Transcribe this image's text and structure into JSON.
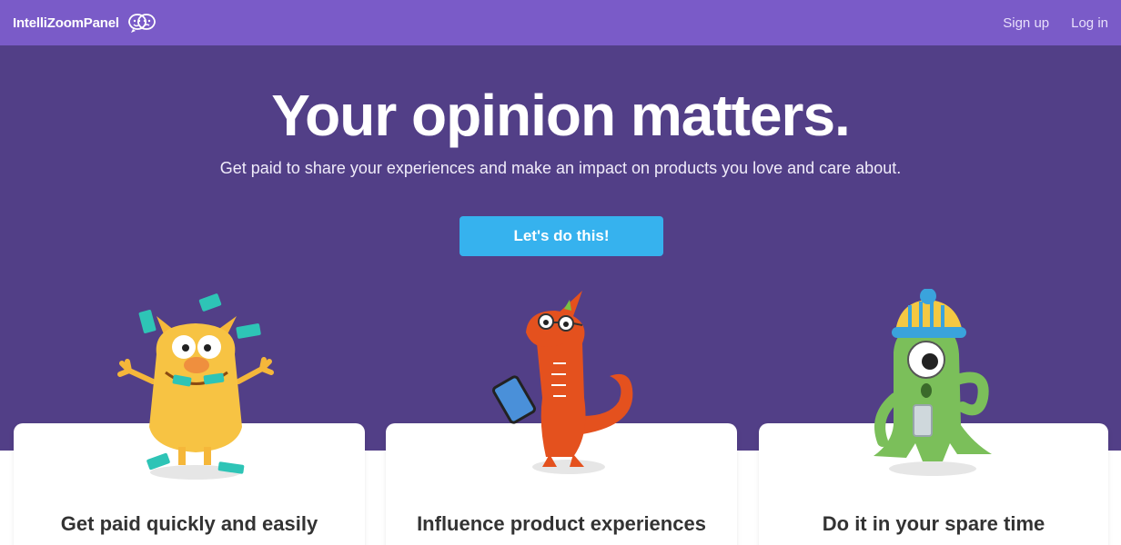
{
  "navbar": {
    "brand": "IntelliZoomPanel",
    "logo_icon": "speech-bubbles-faces-icon",
    "links": [
      {
        "label": "Sign up"
      },
      {
        "label": "Log in"
      }
    ]
  },
  "hero": {
    "title": "Your opinion matters.",
    "subtitle": "Get paid to share your experiences and make an impact on products you love and care about.",
    "cta_label": "Let's do this!"
  },
  "cards": [
    {
      "title": "Get paid quickly and easily",
      "icon": "yellow-monster-with-money-icon"
    },
    {
      "title": "Influence product experiences",
      "icon": "orange-dragon-with-tablet-icon"
    },
    {
      "title": "Do it in your spare time",
      "icon": "green-cyclops-with-phone-icon"
    }
  ],
  "colors": {
    "nav_bg": "#7a5bc8",
    "hero_bg": "#523f87",
    "cta_bg": "#36b2ee",
    "card_bg": "#ffffff",
    "card_title": "#333333"
  }
}
